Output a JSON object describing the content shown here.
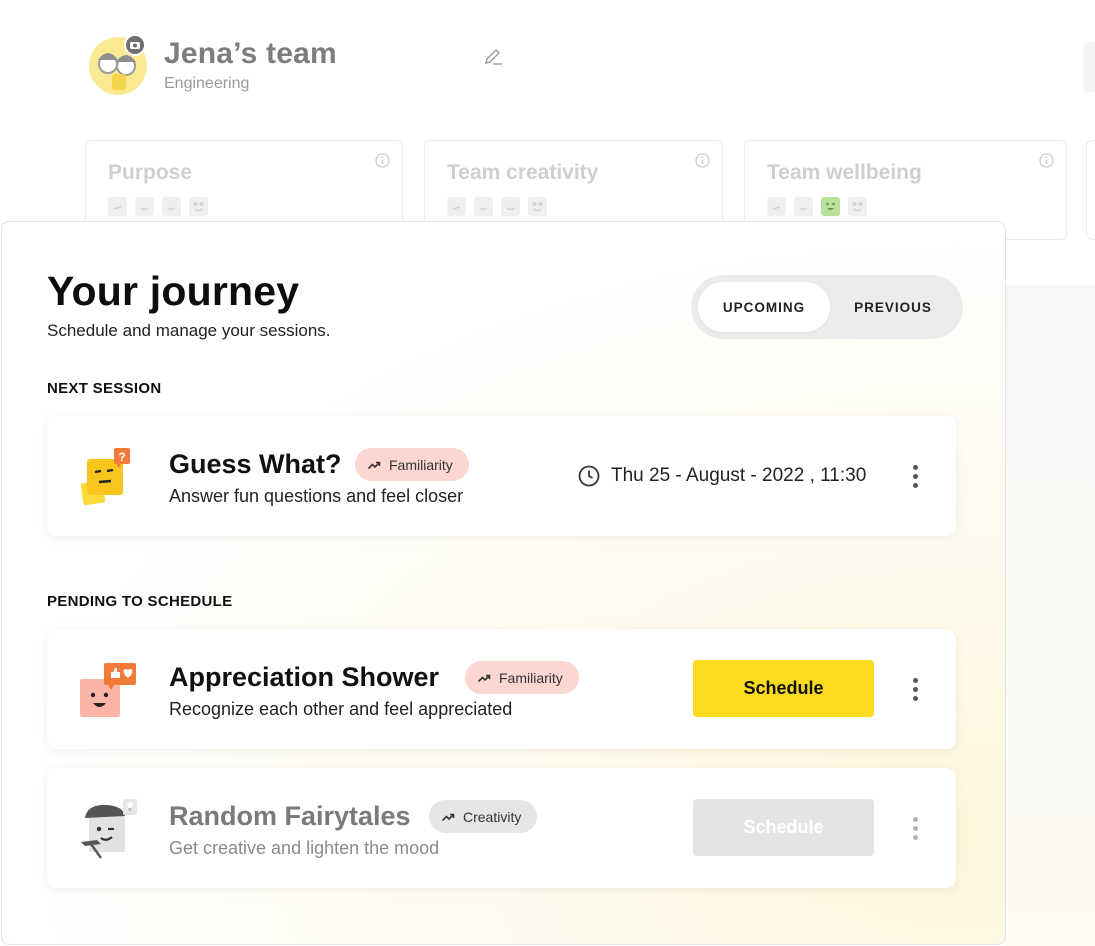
{
  "team": {
    "name": "Jena’s team",
    "department": "Engineering"
  },
  "metrics": [
    {
      "title": "Purpose",
      "active_face": null
    },
    {
      "title": "Team creativity",
      "active_face": null
    },
    {
      "title": "Team wellbeing",
      "active_face": 2
    }
  ],
  "journey": {
    "title": "Your journey",
    "subtitle": "Schedule and manage your sessions.",
    "tabs": [
      {
        "label": "UPCOMING",
        "active": true
      },
      {
        "label": "PREVIOUS",
        "active": false
      }
    ],
    "next_section_label": "NEXT SESSION",
    "pending_section_label": "PENDING TO SCHEDULE",
    "next_session": {
      "title": "Guess What?",
      "tag": "Familiarity",
      "description": "Answer fun questions and feel closer",
      "datetime": "Thu 25 - August - 2022 , 11:30"
    },
    "pending": [
      {
        "title": "Appreciation Shower",
        "tag": "Familiarity",
        "description": "Recognize each other and feel appreciated",
        "button_label": "Schedule",
        "enabled": true
      },
      {
        "title": "Random Fairytales",
        "tag": "Creativity",
        "description": "Get creative and lighten the mood",
        "button_label": "Schedule",
        "enabled": false
      }
    ]
  },
  "colors": {
    "accent_yellow": "#fcdb1f",
    "familiarity_tag": "#fcd6d0",
    "creativity_tag": "#e6e6e6",
    "wellbeing_active_face": "#b9e09a"
  },
  "icons": {
    "edit": "pencil-icon",
    "info": "info-icon",
    "clock": "clock-icon",
    "trend": "trending-up-icon",
    "more": "kebab-menu-icon",
    "camera": "camera-icon"
  }
}
